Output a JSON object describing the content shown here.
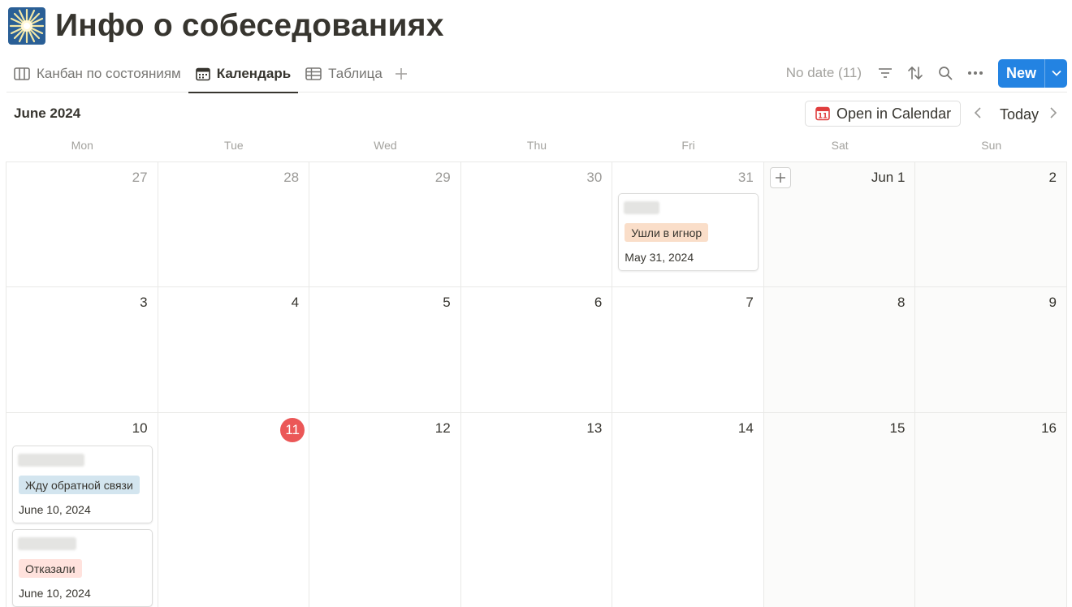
{
  "page": {
    "title": "Инфо о собеседованиях",
    "icon": "sunburst-icon"
  },
  "views": {
    "tabs": [
      {
        "label": "Канбан по состояниям",
        "icon": "columns-icon",
        "active": false
      },
      {
        "label": "Календарь",
        "icon": "calendar-icon",
        "active": true
      },
      {
        "label": "Таблица",
        "icon": "table-icon",
        "active": false
      }
    ],
    "add_view": "+"
  },
  "toolbar": {
    "no_date": "No date (11)",
    "new_label": "New",
    "icons": [
      "filter-icon",
      "sort-icon",
      "search-icon",
      "more-icon",
      "chevron-down-icon"
    ],
    "accent": "#2383e2"
  },
  "calendar": {
    "month": "June 2024",
    "open_in_calendar": "Open in Calendar",
    "today": "Today",
    "weekdays": [
      "Mon",
      "Tue",
      "Wed",
      "Thu",
      "Fri",
      "Sat",
      "Sun"
    ],
    "weeks": [
      [
        "27",
        "28",
        "29",
        "30",
        "31",
        "Jun 1",
        "2"
      ],
      [
        "3",
        "4",
        "5",
        "6",
        "7",
        "8",
        "9"
      ],
      [
        "10",
        "11",
        "12",
        "13",
        "14",
        "15",
        "16"
      ]
    ],
    "today_day": "11",
    "today_color": "#eb5757"
  },
  "events": [
    {
      "status": "Ушли в игнор",
      "date": "May 31, 2024",
      "tag_color": "#fadec9"
    },
    {
      "status": "Жду обратной связи",
      "date": "June 10, 2024",
      "tag_color": "#d3e5ef"
    },
    {
      "status": "Отказали",
      "date": "June 10, 2024",
      "tag_color": "#ffe2dd"
    }
  ]
}
